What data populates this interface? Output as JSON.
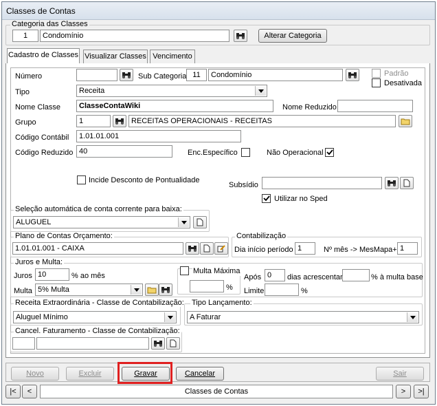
{
  "window": {
    "title": "Classes de Contas"
  },
  "categoria": {
    "legend": "Categoria das Classes",
    "code": "1",
    "name": "Condomínio",
    "alterar_label": "Alterar Categoria"
  },
  "tabs": [
    {
      "label": "Cadastro de Classes"
    },
    {
      "label": "Visualizar Classes"
    },
    {
      "label": "Vencimento"
    }
  ],
  "form": {
    "numero_label": "Número",
    "numero_value": "",
    "subcategoria_label": "Sub Categoria",
    "subcategoria_code": "11",
    "subcategoria_name": "Condomínio",
    "padrao_label": "Padrão",
    "desativada_label": "Desativada",
    "tipo_label": "Tipo",
    "tipo_value": "Receita",
    "nome_classe_label": "Nome Classe",
    "nome_classe_value": "ClasseContaWiki",
    "nome_reduzido_label": "Nome Reduzido",
    "nome_reduzido_value": "",
    "grupo_label": "Grupo",
    "grupo_code": "1",
    "grupo_name": "RECEITAS OPERACIONAIS - RECEITAS",
    "codigo_contabil_label": "Código Contábil",
    "codigo_contabil_value": "1.01.01.001",
    "codigo_reduzido_label": "Código Reduzido",
    "codigo_reduzido_value": "40",
    "enc_especifico_label": "Enc.Específico",
    "nao_operacional_label": "Não Operacional",
    "incide_desconto_label": "Incide Desconto de Pontualidade",
    "subsidio_label": "Subsídio",
    "subsidio_value": "",
    "utilizar_sped_label": "Utilizar no Sped"
  },
  "selecao": {
    "legend": "Seleção automática de conta corrente para baixa:",
    "value": "ALUGUEL"
  },
  "plano": {
    "legend": "Plano de Contas Orçamento:",
    "value": "1.01.01.001 - CAIXA"
  },
  "contabilizacao": {
    "legend": "Contabilização",
    "dia_label": "Dia início período",
    "dia_value": "1",
    "mes_label": "Nº mês -> MesMapa+",
    "mes_value": "1"
  },
  "juros": {
    "legend": "Juros e Multa:",
    "juros_label": "Juros",
    "juros_value": "10",
    "ao_mes_label": "% ao mês",
    "multa_label": "Multa",
    "multa_value": "5% Multa",
    "multa_maxima_label": "Multa Máxima",
    "multa_maxima_value": "",
    "pct_label": "%",
    "apos_label": "Após",
    "apos_value": "0",
    "dias_label": "dias acrescentar",
    "dias_value": "",
    "multa_base_label": "% à multa base",
    "limite_label": "Limite",
    "limite_value": "",
    "limite_pct_label": "%"
  },
  "receita_extra": {
    "legend": "Receita Extraordinária - Classe de Contabilização:",
    "value": "Aluguel Mínimo"
  },
  "tipo_lanc": {
    "legend": "Tipo Lançamento:",
    "value": "A Faturar"
  },
  "cancel": {
    "legend": "Cancel. Faturamento - Classe de Contabilização:",
    "code": "",
    "name": ""
  },
  "buttons": {
    "novo": "Novo",
    "excluir": "Excluir",
    "gravar": "Gravar",
    "cancelar": "Cancelar",
    "sair": "Sair"
  },
  "nav": {
    "first": "|<",
    "prev": "<",
    "next": ">",
    "last": ">|",
    "status": "Classes de Contas"
  },
  "colors": {
    "highlight": "#e02020",
    "title_bg": "#dfe7f0",
    "panel_bg": "#ffffff",
    "window_bg": "#f0f0f0"
  }
}
